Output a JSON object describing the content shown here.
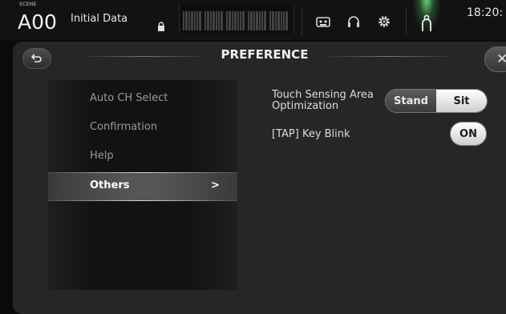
{
  "status_bar": {
    "scene_label": "SCENE",
    "scene_number": "A00",
    "scene_name": "Initial Data",
    "icons": [
      "lock-icon",
      "cassette-icon",
      "headphones-icon",
      "gear-icon",
      "user-icon"
    ],
    "time": "18:20:"
  },
  "dialog": {
    "title": "PREFERENCE",
    "back_icon": "back-arrow-icon",
    "close_icon": "close-icon"
  },
  "menu": {
    "items": [
      {
        "label": "Auto CH Select"
      },
      {
        "label": "Confirmation"
      },
      {
        "label": "Help"
      },
      {
        "label": "Others",
        "arrow": ">"
      }
    ],
    "selected": "Others"
  },
  "settings": {
    "touch_sensing": {
      "label_line1": "Touch Sensing Area",
      "label_line2": "Optimization",
      "options": [
        "Stand",
        "Sit"
      ],
      "selected": "Sit"
    },
    "tap_key_blink": {
      "label": "[TAP] Key Blink",
      "value": "ON"
    }
  },
  "colors": {
    "accent_green": "#6edc78",
    "panel_bg": "#262626",
    "selected_button": "#ffffff"
  }
}
